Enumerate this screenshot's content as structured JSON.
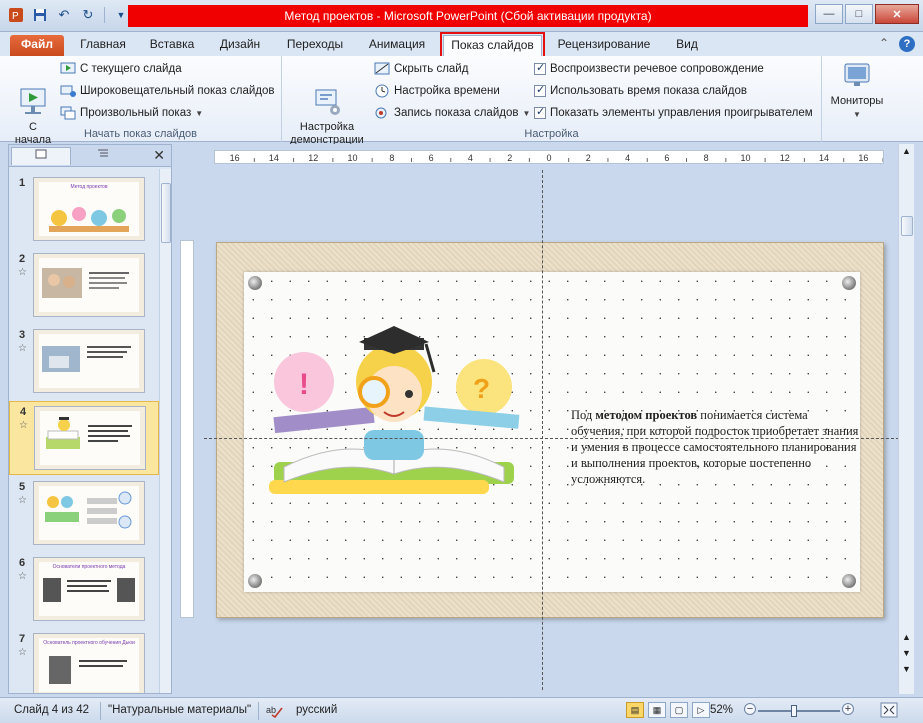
{
  "window": {
    "title": "Метод проектов  -  Microsoft PowerPoint (Сбой активации продукта)"
  },
  "tabs": [
    {
      "label": "Файл"
    },
    {
      "label": "Главная"
    },
    {
      "label": "Вставка"
    },
    {
      "label": "Дизайн"
    },
    {
      "label": "Переходы"
    },
    {
      "label": "Анимация"
    },
    {
      "label": "Показ слайдов"
    },
    {
      "label": "Рецензирование"
    },
    {
      "label": "Вид"
    }
  ],
  "ribbon": {
    "start_group": {
      "label": "Начать показ слайдов",
      "from_start": "С\nначала",
      "from_current": "С текущего слайда",
      "broadcast": "Широковещательный показ слайдов",
      "custom": "Произвольный показ"
    },
    "setup_group": {
      "label": "Настройка",
      "setup": "Настройка\nдемонстрации",
      "hide": "Скрыть слайд",
      "rehearse": "Настройка времени",
      "record": "Запись показа слайдов",
      "play_narrations": "Воспроизвести речевое сопровождение",
      "use_timings": "Использовать время показа слайдов",
      "show_controls": "Показать элементы управления проигрывателем"
    },
    "monitors": "Мониторы"
  },
  "thumbnails": [
    {
      "num": "1",
      "title": "Метод проектов"
    },
    {
      "num": "2"
    },
    {
      "num": "3"
    },
    {
      "num": "4"
    },
    {
      "num": "5"
    },
    {
      "num": "6",
      "title": "Основатели проектного метода"
    },
    {
      "num": "7",
      "title": "Основатель проектного обучения Дьюи"
    }
  ],
  "slide": {
    "text_plain_1": "Под ",
    "text_bold": "методом проектов",
    "text_plain_2": " понимается система обучения, при которой подросток приобретает знания и умения в процессе самостоятельного планирования и выполнения проектов, которые постепенно усложняются."
  },
  "ruler_labels": [
    "16",
    "14",
    "12",
    "10",
    "8",
    "6",
    "4",
    "2",
    "0",
    "2",
    "4",
    "6",
    "8",
    "10",
    "12",
    "14",
    "16"
  ],
  "statusbar": {
    "slide_info": "Слайд 4 из 42",
    "theme": "\"Натуральные материалы\"",
    "language": "русский",
    "zoom": "52%",
    "zoom_fraction": 0.52
  }
}
